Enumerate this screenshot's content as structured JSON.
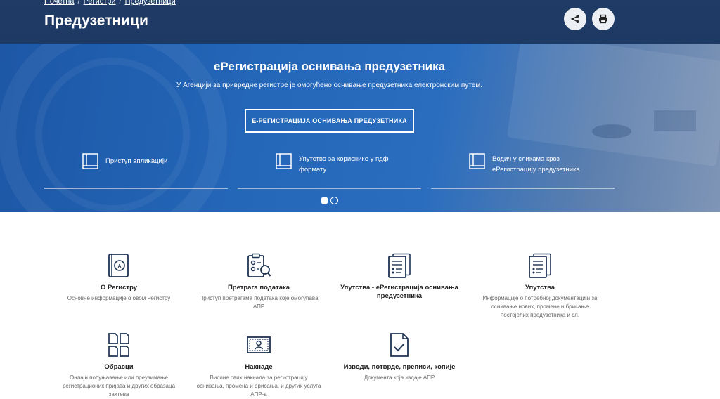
{
  "breadcrumb": {
    "home": "Почетна",
    "registers": "Регистри",
    "current": "Предузетници",
    "separator": "/"
  },
  "header": {
    "title": "Предузетници",
    "share_icon": "share-icon",
    "print_icon": "printer-icon"
  },
  "hero": {
    "title": "еРегистрација оснивања предузетника",
    "subtitle": "У Агенцији за привредне регистре је омогућено оснивање предузетника електронским путем.",
    "cta_label": "Е-РЕГИСТРАЦИЈА ОСНИВАЊА ПРЕДУЗЕТНИКА",
    "links": [
      {
        "line1": "Приступ апликацији",
        "line2": "",
        "icon": "book-icon"
      },
      {
        "line1": "Упутство за кориснике у пдф",
        "line2": "формату",
        "icon": "book-icon"
      },
      {
        "line1": "Водич у сликама кроз",
        "line2": "еРегистрацију предузетника",
        "icon": "book-icon"
      }
    ],
    "slides": 2,
    "active_slide": 1
  },
  "cards": [
    {
      "title": "О Регистру",
      "desc": "Основне информације о овом Регистру",
      "icon": "register-book-icon"
    },
    {
      "title": "Претрага података",
      "desc": "Приступ претрагама података које омогућава АПР",
      "icon": "data-search-icon"
    },
    {
      "title": "Упутства - еРегистрација оснивања предузетника",
      "desc": "",
      "icon": "document-list-icon"
    },
    {
      "title": "Упутства",
      "desc": "Информације о потребној документацији за оснивање нових, промене и брисање постојећих предузетника и сл.",
      "icon": "document-list-icon"
    },
    {
      "title": "Обрасци",
      "desc": "Онлајн попуњавање или преузимање регистрационих пријава и других образаца захтева",
      "icon": "forms-icon"
    },
    {
      "title": "Накнаде",
      "desc": "Висине свих накнада за регистрацију оснивања, промена и брисања, и других услуга АПР-а",
      "icon": "fees-banknote-icon"
    },
    {
      "title": "Изводи, потврде, преписи, копије",
      "desc": "Документа која издаје АПР",
      "icon": "document-check-icon"
    }
  ],
  "colors": {
    "header_bg": "#1f3b66",
    "hero_bg": "#2466b8",
    "icon_stroke": "#1e3353"
  }
}
